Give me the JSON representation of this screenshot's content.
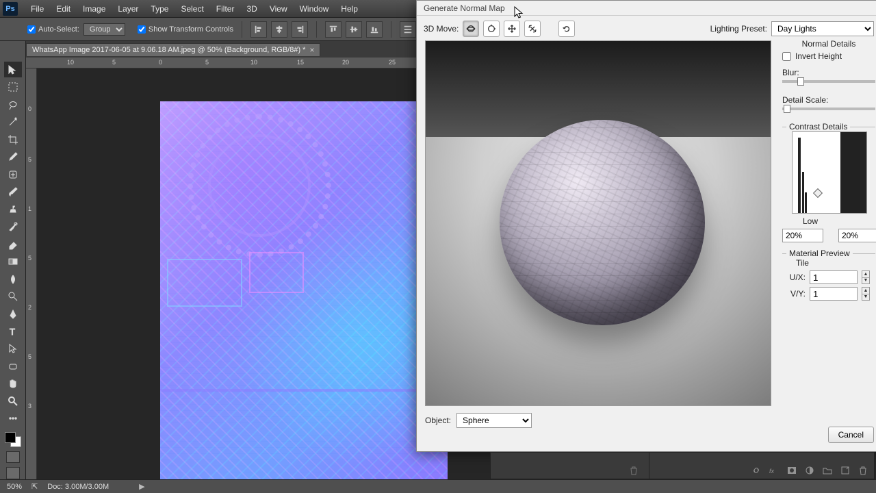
{
  "app": {
    "logo_text": "Ps"
  },
  "menu": [
    "File",
    "Edit",
    "Image",
    "Layer",
    "Type",
    "Select",
    "Filter",
    "3D",
    "View",
    "Window",
    "Help"
  ],
  "options": {
    "auto_select_label": "Auto-Select:",
    "auto_select_value": "Group",
    "show_transform_label": "Show Transform Controls",
    "auto_select_checked": true,
    "show_transform_checked": true
  },
  "document": {
    "tab_title": "WhatsApp Image 2017-06-05 at 9.06.18 AM.jpeg @ 50% (Background, RGB/8#) *"
  },
  "ruler_h": [
    "10",
    "5",
    "0",
    "5",
    "10",
    "15",
    "20",
    "25"
  ],
  "ruler_v": [
    "0",
    "5",
    "1",
    "5",
    "2",
    "5",
    "3"
  ],
  "dialog": {
    "title": "Generate Normal Map",
    "move_label": "3D Move:",
    "lighting_label": "Lighting Preset:",
    "lighting_value": "Day Lights",
    "object_label": "Object:",
    "object_value": "Sphere",
    "normal_details": {
      "title": "Normal Details",
      "invert_label": "Invert Height",
      "invert_checked": false,
      "blur_label": "Blur:",
      "detail_scale_label": "Detail Scale:"
    },
    "contrast": {
      "title": "Contrast Details",
      "low_label": "Low",
      "low_value": "20%",
      "high_value": "20%"
    },
    "material": {
      "title": "Material Preview",
      "tile_label": "Tile",
      "ux_label": "U/X:",
      "ux_value": "1",
      "vy_label": "V/Y:",
      "vy_value": "1"
    },
    "cancel_label": "Cancel"
  },
  "status": {
    "zoom": "50%",
    "doc_info": "Doc: 3.00M/3.00M"
  }
}
